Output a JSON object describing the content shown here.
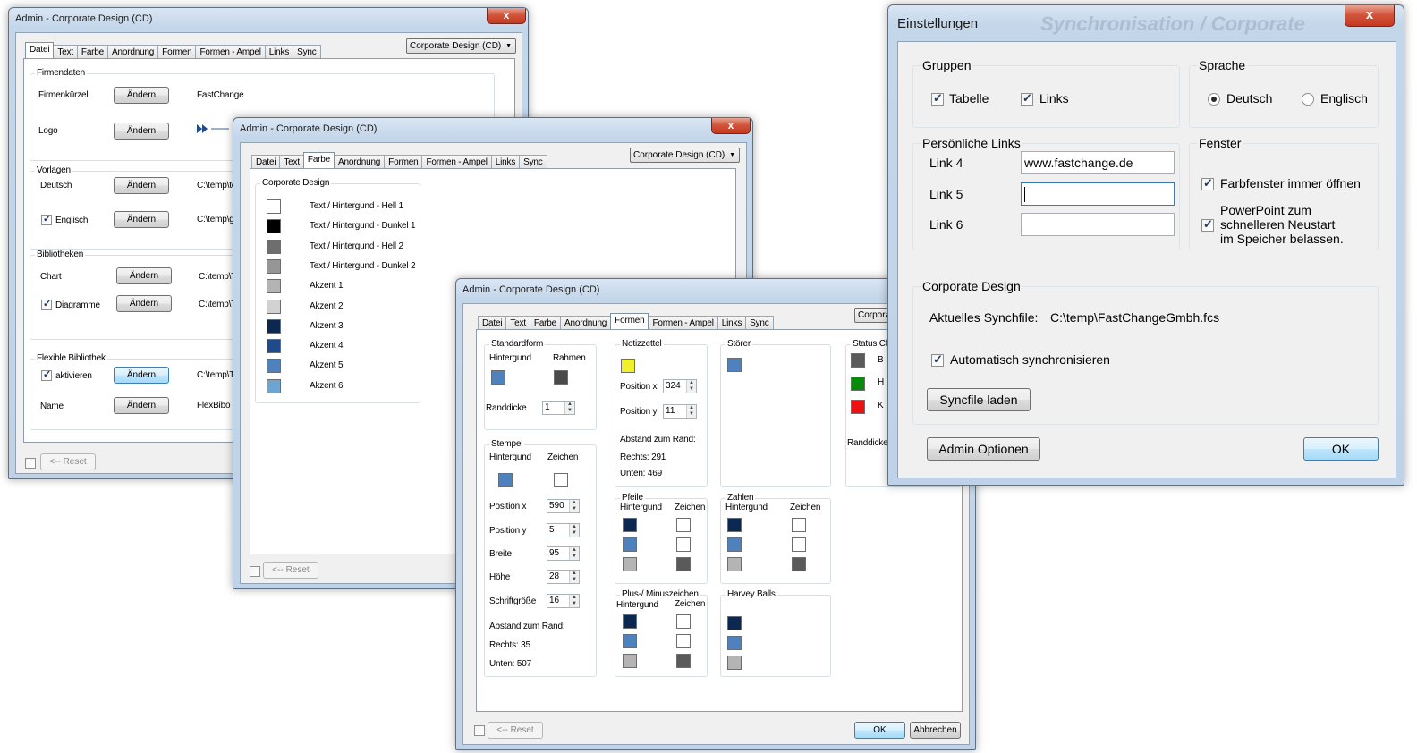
{
  "win1": {
    "title": "Admin - Corporate Design (CD)",
    "close": "x",
    "tabs": [
      "Datei",
      "Text",
      "Farbe",
      "Anordnung",
      "Formen",
      "Formen - Ampel",
      "Links",
      "Sync"
    ],
    "combo": "Corporate Design (CD)",
    "firmendaten": {
      "title": "Firmendaten",
      "kuerzel_label": "Firmenkürzel",
      "kuerzel_btn": "Ändern",
      "kuerzel_value": "FastChange",
      "logo_label": "Logo",
      "logo_btn": "Ändern"
    },
    "vorlagen": {
      "title": "Vorlagen",
      "deutsch_label": "Deutsch",
      "deutsch_btn": "Ändern",
      "deutsch_value": "C:\\temp\\te",
      "englisch_label": "Englisch",
      "englisch_btn": "Ändern",
      "englisch_value": "C:\\temp\\gl"
    },
    "bibliotheken": {
      "title": "Bibliotheken",
      "chart_label": "Chart",
      "chart_btn": "Ändern",
      "chart_value": "C:\\temp\\T",
      "diagramme_label": "Diagramme",
      "diagramme_btn": "Ändern",
      "diagramme_value": "C:\\temp\\T"
    },
    "flex": {
      "title": "Flexible Bibliothek",
      "aktivieren_label": "aktivieren",
      "aktivieren_btn": "Ändern",
      "aktivieren_value": "C:\\temp\\T",
      "name_label": "Name",
      "name_btn": "Ändern",
      "name_value": "FlexBibo"
    },
    "reset": "<-- Reset"
  },
  "win2": {
    "title": "Admin - Corporate Design (CD)",
    "close": "x",
    "tabs": [
      "Datei",
      "Text",
      "Farbe",
      "Anordnung",
      "Formen",
      "Formen - Ampel",
      "Links",
      "Sync"
    ],
    "combo": "Corporate Design (CD)",
    "group_title": "Corporate Design",
    "colors": [
      {
        "label": "Text / Hintergund - Hell 1",
        "color": "#ffffff"
      },
      {
        "label": "Text / Hintergund - Dunkel 1",
        "color": "#000000"
      },
      {
        "label": "Text / Hintergund - Hell 2",
        "color": "#6e6e6e"
      },
      {
        "label": "Text / Hintergund - Dunkel 2",
        "color": "#969696"
      },
      {
        "label": "Akzent 1",
        "color": "#b4b4b4"
      },
      {
        "label": "Akzent 2",
        "color": "#d2d2d2"
      },
      {
        "label": "Akzent 3",
        "color": "#0a2850"
      },
      {
        "label": "Akzent 4",
        "color": "#1f4b8c"
      },
      {
        "label": "Akzent 5",
        "color": "#4f81bd"
      },
      {
        "label": "Akzent 6",
        "color": "#6fa3d2"
      }
    ],
    "reset": "<-- Reset"
  },
  "win3": {
    "title": "Admin - Corporate Design (CD)",
    "tabs": [
      "Datei",
      "Text",
      "Farbe",
      "Anordnung",
      "Formen",
      "Formen - Ampel",
      "Links",
      "Sync"
    ],
    "combo": "Corporate",
    "standardform": {
      "title": "Standardform",
      "hintergrund": "Hintergund",
      "rahmen": "Rahmen",
      "randdicke_label": "Randdicke",
      "randdicke": "1"
    },
    "stempel": {
      "title": "Stempel",
      "hintergrund": "Hintergund",
      "zeichen": "Zeichen",
      "posx_label": "Position x",
      "posx": "590",
      "posy_label": "Position y",
      "posy": "5",
      "breite_label": "Breite",
      "breite": "95",
      "hoehe_label": "Höhe",
      "hoehe": "28",
      "schrift_label": "Schriftgröße",
      "schrift": "16",
      "abstand": "Abstand zum Rand:",
      "rechts": "Rechts: 35",
      "unten": "Unten: 507"
    },
    "notiz": {
      "title": "Notizzettel",
      "posx_label": "Position x",
      "posx": "324",
      "posy_label": "Position y",
      "posy": "11",
      "abstand": "Abstand zum Rand:",
      "rechts": "Rechts: 291",
      "unten": "Unten: 469"
    },
    "pfeile": {
      "title": "Pfeile",
      "hintergrund": "Hintergund",
      "zeichen": "Zeichen"
    },
    "plusminus": {
      "title": "Plus-/ Minuszeichen",
      "hintergrund": "Hintergund",
      "zeichen": "Zeichen"
    },
    "stoerer": {
      "title": "Störer"
    },
    "zahlen": {
      "title": "Zahlen",
      "hintergrund": "Hintergund",
      "zeichen": "Zeichen"
    },
    "harvey": {
      "title": "Harvey Balls"
    },
    "status": {
      "title": "Status Che",
      "b": "B",
      "h": "H",
      "k": "K",
      "randdicke": "Randdicke"
    },
    "reset": "<-- Reset",
    "ok": "OK",
    "abbrechen": "Abbrechen"
  },
  "win4": {
    "title": "Einstellungen",
    "close": "x",
    "bg_text": "Synchronisation / Corporate",
    "gruppen": {
      "title": "Gruppen",
      "tabelle": "Tabelle",
      "links": "Links"
    },
    "sprache": {
      "title": "Sprache",
      "deutsch": "Deutsch",
      "englisch": "Englisch"
    },
    "links": {
      "title": "Persönliche Links",
      "link4": "Link 4",
      "link4_value": "www.fastchange.de",
      "link5": "Link 5",
      "link5_value": "",
      "link6": "Link 6",
      "link6_value": ""
    },
    "fenster": {
      "title": "Fenster",
      "farbfenster": "Farbfenster immer öffnen",
      "pp1": "PowerPoint zum",
      "pp2": "schnelleren Neustart",
      "pp3": "im Speicher belassen."
    },
    "cd": {
      "title": "Corporate Design",
      "synch_label": "Aktuelles Synchfile:",
      "synch_value": "C:\\temp\\FastChangeGmbh.fcs",
      "auto": "Automatisch synchronisieren",
      "load": "Syncfile laden"
    },
    "admin": "Admin Optionen",
    "ok": "OK"
  }
}
